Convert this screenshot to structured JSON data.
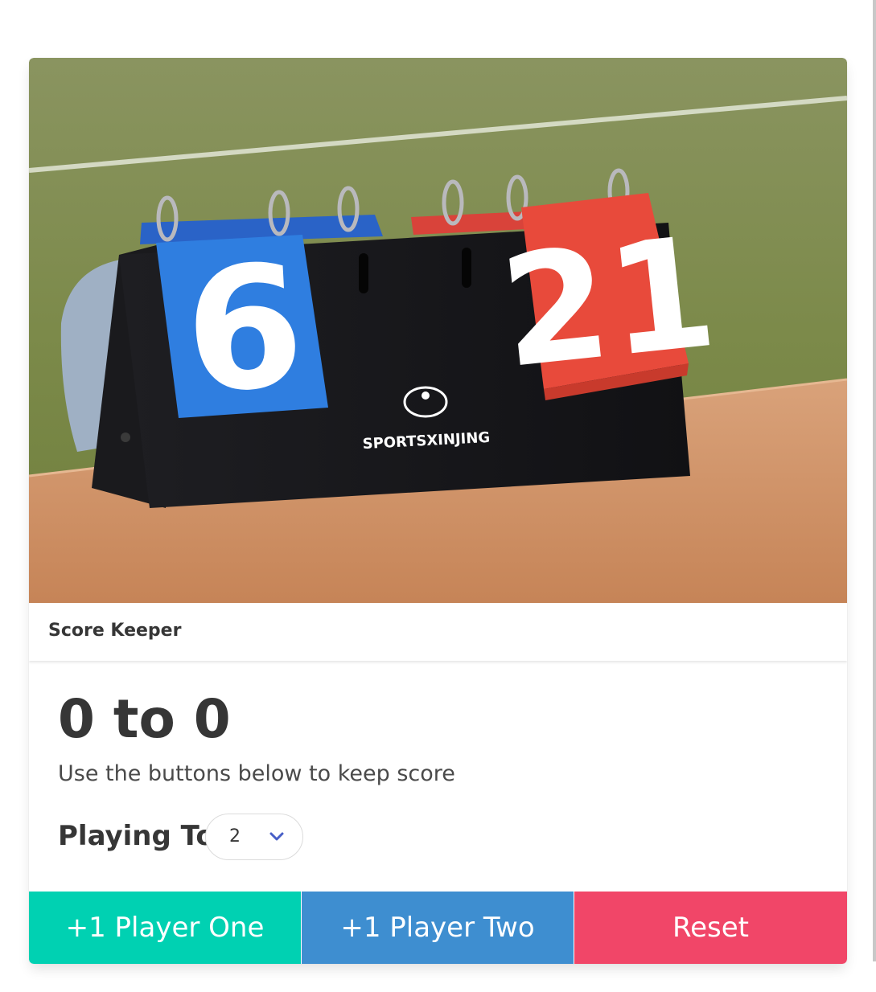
{
  "card": {
    "title": "Score Keeper",
    "image_alt_digits": {
      "left_card": "6",
      "right_card": "21",
      "brand": "SPORTSXINJING"
    }
  },
  "score": {
    "player_one": 0,
    "player_two": 0,
    "text": "0 to 0",
    "subtitle": "Use the buttons below to keep score"
  },
  "playing_to": {
    "label": "Playing To",
    "selected": "2"
  },
  "buttons": {
    "player_one": "+1 Player One",
    "player_two": "+1 Player Two",
    "reset": "Reset"
  },
  "colors": {
    "primary": "#00d1b2",
    "info": "#3e8ed0",
    "danger": "#f14668",
    "text": "#363636"
  }
}
